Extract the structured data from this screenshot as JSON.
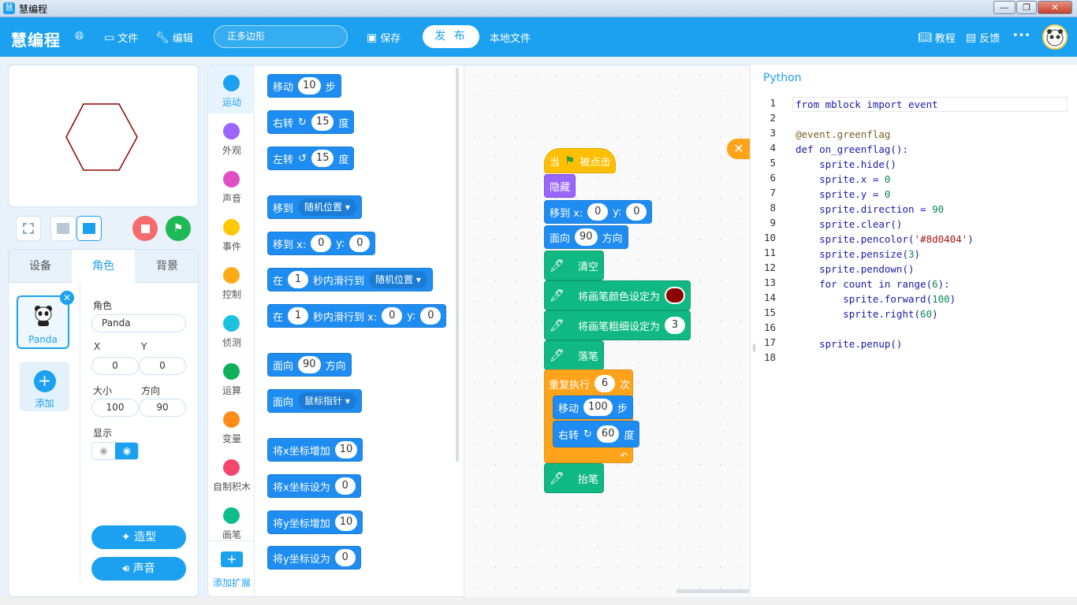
{
  "window": {
    "title": "慧编程",
    "min": "—",
    "max": "❐",
    "close": "✕"
  },
  "header": {
    "logo": "慧编程",
    "file": "文件",
    "edit": "编辑",
    "project_name": "正多边形",
    "save": "保存",
    "publish": "发 布",
    "local_file": "本地文件",
    "tutorial": "教程",
    "feedback": "反馈",
    "more": "•••"
  },
  "stage_controls": {
    "stop_color": "#f56c6c",
    "go_color": "#1db954"
  },
  "sprite_panel": {
    "tabs": [
      "设备",
      "角色",
      "背景"
    ],
    "sprite_name": "Panda",
    "add_label": "添加",
    "role_label": "角色",
    "role_value": "Panda",
    "x_label": "X",
    "y_label": "Y",
    "x_value": "0",
    "y_value": "0",
    "size_label": "大小",
    "direction_label": "方向",
    "size_value": "100",
    "direction_value": "90",
    "show_label": "显示",
    "costume_button": "造型",
    "sound_button": "声音"
  },
  "categories": [
    {
      "label": "运动",
      "color": "#1ba1f0"
    },
    {
      "label": "外观",
      "color": "#9966ff"
    },
    {
      "label": "声音",
      "color": "#e04ec4"
    },
    {
      "label": "事件",
      "color": "#ffc800"
    },
    {
      "label": "控制",
      "color": "#ffab19"
    },
    {
      "label": "侦测",
      "color": "#1cc1e0"
    },
    {
      "label": "运算",
      "color": "#10b05a"
    },
    {
      "label": "变量",
      "color": "#ff8c1a"
    },
    {
      "label": "自制积木",
      "color": "#f5466e"
    },
    {
      "label": "画笔",
      "color": "#0fbd8c"
    }
  ],
  "add_extension": "添加扩展",
  "palette": {
    "move": {
      "a": "移动",
      "v": "10",
      "b": "步"
    },
    "turn_right": {
      "a": "右转",
      "v": "15",
      "b": "度"
    },
    "turn_left": {
      "a": "左转",
      "v": "15",
      "b": "度"
    },
    "goto": {
      "a": "移到",
      "d": "随机位置"
    },
    "goto_xy": {
      "a": "移到 x:",
      "x": "0",
      "yl": "y:",
      "y": "0"
    },
    "glide": {
      "a": "在",
      "v": "1",
      "b": "秒内滑行到",
      "d": "随机位置"
    },
    "glide_xy": {
      "a": "在",
      "v": "1",
      "b": "秒内滑行到 x:",
      "x": "0",
      "yl": "y:",
      "y": "0"
    },
    "point": {
      "a": "面向",
      "v": "90",
      "b": "方向"
    },
    "point_to": {
      "a": "面向",
      "d": "鼠标指针"
    },
    "change_x": {
      "a": "将x坐标增加",
      "v": "10"
    },
    "set_x": {
      "a": "将x坐标设为",
      "v": "0"
    },
    "change_y": {
      "a": "将y坐标增加",
      "v": "10"
    },
    "set_y": {
      "a": "将y坐标设为",
      "v": "0"
    }
  },
  "script": {
    "hat": {
      "a": "当",
      "b": "被点击"
    },
    "hide": "隐藏",
    "goto": {
      "a": "移到 x:",
      "x": "0",
      "yl": "y:",
      "y": "0"
    },
    "point": {
      "a": "面向",
      "v": "90",
      "b": "方向"
    },
    "clear": "清空",
    "pen_color": {
      "a": "将画笔颜色设定为",
      "color": "#8d0404"
    },
    "pen_size": {
      "a": "将画笔粗细设定为",
      "v": "3"
    },
    "pen_down": "落笔",
    "repeat": {
      "a": "重复执行",
      "v": "6",
      "b": "次"
    },
    "move": {
      "a": "移动",
      "v": "100",
      "b": "步"
    },
    "turn": {
      "a": "右转",
      "v": "60",
      "b": "度"
    },
    "pen_up": "抬笔"
  },
  "python": {
    "title": "Python",
    "lines": [
      "from mblock import event",
      "",
      "@event.greenflag",
      "def on_greenflag():",
      "    sprite.hide()",
      "    sprite.x = 0",
      "    sprite.y = 0",
      "    sprite.direction = 90",
      "    sprite.clear()",
      "    sprite.pencolor('#8d0404')",
      "    sprite.pensize(3)",
      "    sprite.pendown()",
      "    for count in range(6):",
      "        sprite.forward(100)",
      "        sprite.right(60)",
      "",
      "    sprite.penup()",
      ""
    ]
  }
}
